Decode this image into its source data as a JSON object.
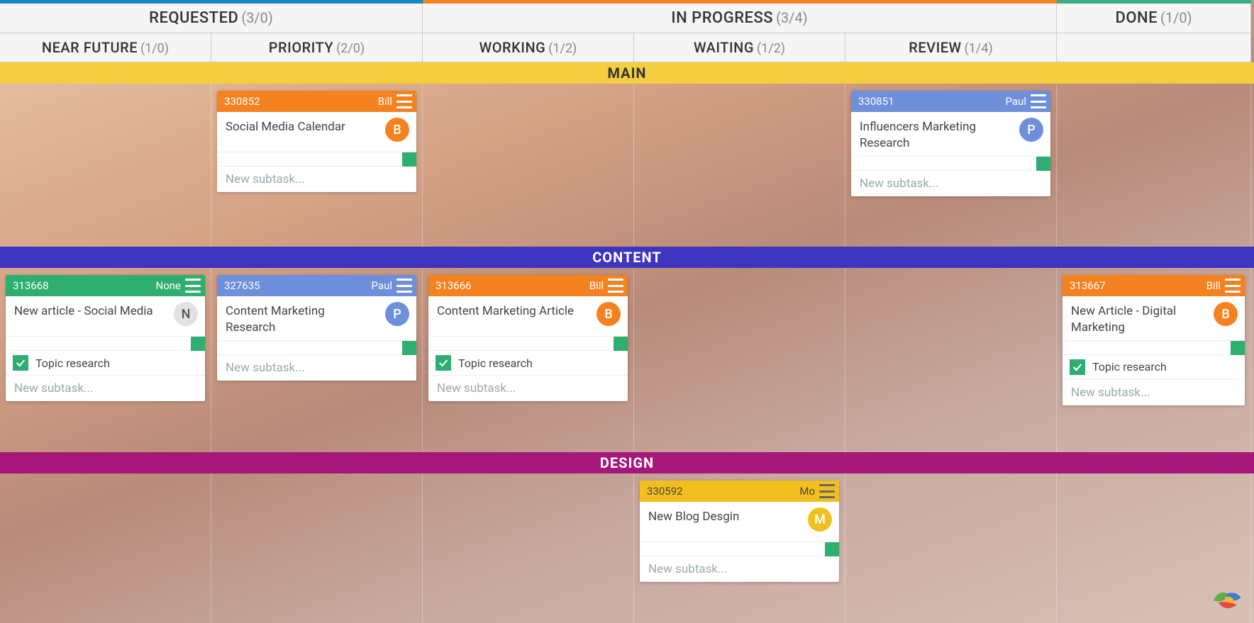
{
  "columns": {
    "requested": {
      "label": "REQUESTED",
      "count": "(3/0)"
    },
    "in_progress": {
      "label": "IN PROGRESS",
      "count": "(3/4)"
    },
    "done": {
      "label": "DONE",
      "count": "(1/0)"
    }
  },
  "subcolumns": {
    "near_future": {
      "label": "NEAR FUTURE",
      "count": "(1/0)"
    },
    "priority": {
      "label": "PRIORITY",
      "count": "(2/0)"
    },
    "working": {
      "label": "WORKING",
      "count": "(1/2)"
    },
    "waiting": {
      "label": "WAITING",
      "count": "(1/2)"
    },
    "review": {
      "label": "REVIEW",
      "count": "(1/4)"
    }
  },
  "swimlanes": {
    "main": {
      "label": "MAIN"
    },
    "content": {
      "label": "CONTENT"
    },
    "design": {
      "label": "DESIGN"
    }
  },
  "cards": {
    "c330852": {
      "id": "330852",
      "assignee": "Bill",
      "avatar": "B",
      "title": "Social Media Calendar"
    },
    "c330851": {
      "id": "330851",
      "assignee": "Paul",
      "avatar": "P",
      "title": "Influencers Marketing Research"
    },
    "c313668": {
      "id": "313668",
      "assignee": "None",
      "avatar": "N",
      "title": "New article - Social Media",
      "subtask": "Topic research"
    },
    "c327635": {
      "id": "327635",
      "assignee": "Paul",
      "avatar": "P",
      "title": "Content Marketing Research"
    },
    "c313666": {
      "id": "313666",
      "assignee": "Bill",
      "avatar": "B",
      "title": "Content Marketing Article",
      "subtask": "Topic research"
    },
    "c313667": {
      "id": "313667",
      "assignee": "Bill",
      "avatar": "B",
      "title": "New Article - Digital Marketing",
      "subtask": "Topic research"
    },
    "c330592": {
      "id": "330592",
      "assignee": "Mo",
      "avatar": "M",
      "title": "New Blog Desgin"
    }
  },
  "ui": {
    "new_subtask": "New subtask..."
  }
}
